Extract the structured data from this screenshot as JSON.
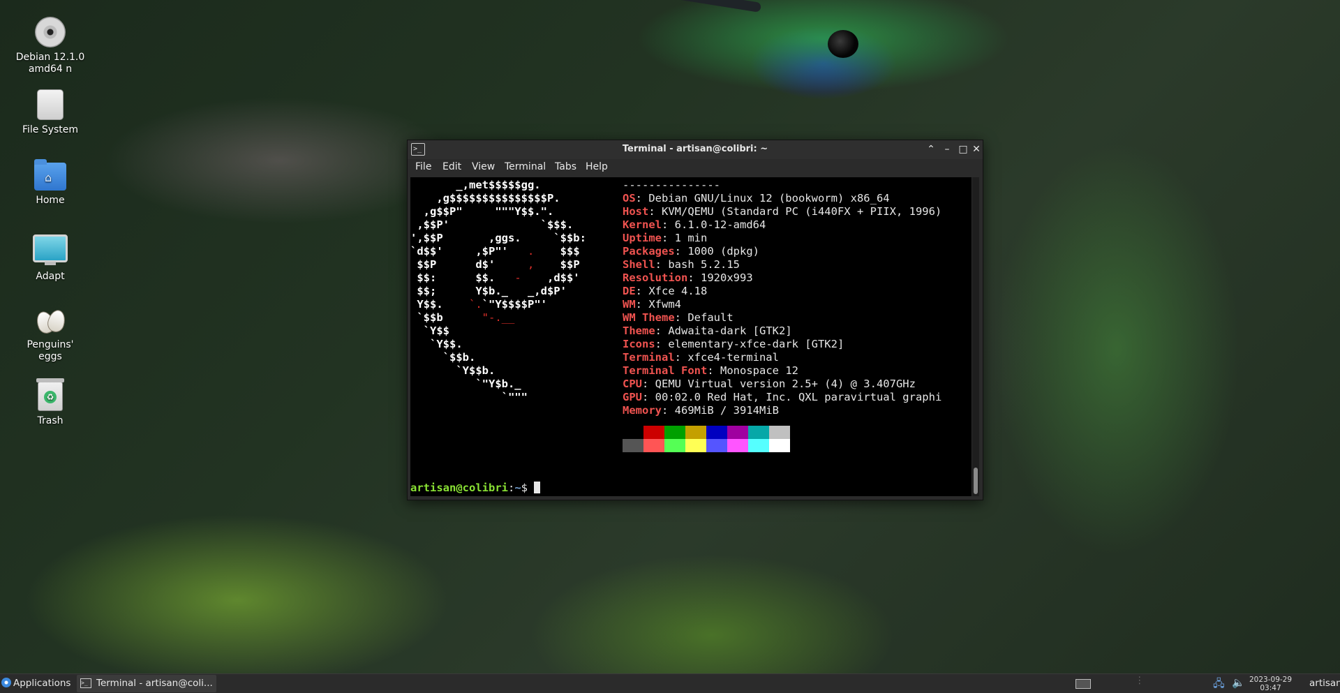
{
  "desktop": {
    "icons": [
      {
        "label": "Debian 12.1.0\namd64 n",
        "icon": "disc-icon"
      },
      {
        "label": "File System",
        "icon": "drive-icon"
      },
      {
        "label": "Home",
        "icon": "home-folder-icon"
      },
      {
        "label": "Adapt",
        "icon": "monitor-icon"
      },
      {
        "label": "Penguins'\neggs",
        "icon": "eggs-icon"
      },
      {
        "label": "Trash",
        "icon": "trash-icon"
      }
    ]
  },
  "window": {
    "title": "Terminal - artisan@colibri: ~",
    "menu": [
      "File",
      "Edit",
      "View",
      "Terminal",
      "Tabs",
      "Help"
    ]
  },
  "terminal": {
    "separator": "---------------",
    "info": [
      {
        "key": "OS",
        "value": "Debian GNU/Linux 12 (bookworm) x86_64"
      },
      {
        "key": "Host",
        "value": "KVM/QEMU (Standard PC (i440FX + PIIX, 1996)"
      },
      {
        "key": "Kernel",
        "value": "6.1.0-12-amd64"
      },
      {
        "key": "Uptime",
        "value": "1 min"
      },
      {
        "key": "Packages",
        "value": "1000 (dpkg)"
      },
      {
        "key": "Shell",
        "value": "bash 5.2.15"
      },
      {
        "key": "Resolution",
        "value": "1920x993"
      },
      {
        "key": "DE",
        "value": "Xfce 4.18"
      },
      {
        "key": "WM",
        "value": "Xfwm4"
      },
      {
        "key": "WM Theme",
        "value": "Default"
      },
      {
        "key": "Theme",
        "value": "Adwaita-dark [GTK2]"
      },
      {
        "key": "Icons",
        "value": "elementary-xfce-dark [GTK2]"
      },
      {
        "key": "Terminal",
        "value": "xfce4-terminal"
      },
      {
        "key": "Terminal Font",
        "value": "Monospace 12"
      },
      {
        "key": "CPU",
        "value": "QEMU Virtual version 2.5+ (4) @ 3.407GHz"
      },
      {
        "key": "GPU",
        "value": "00:02.0 Red Hat, Inc. QXL paravirtual graphi"
      },
      {
        "key": "Memory",
        "value": "469MiB / 3914MiB"
      }
    ],
    "palette_top": [
      "#000000",
      "#cc0000",
      "#00a000",
      "#c4a000",
      "#0000c0",
      "#a000a0",
      "#06a8a8",
      "#c0c0c0"
    ],
    "palette_bottom": [
      "#555555",
      "#ff5555",
      "#55ff55",
      "#ffff55",
      "#5555ff",
      "#ff55ff",
      "#55ffff",
      "#ffffff"
    ],
    "prompt": {
      "user_host": "artisan@colibri",
      "path": "~",
      "symbol": "$ "
    }
  },
  "panel": {
    "applications": "Applications",
    "task": "Terminal - artisan@coli...",
    "date": "2023-09-29",
    "time": "03:47",
    "user": "artisan"
  }
}
